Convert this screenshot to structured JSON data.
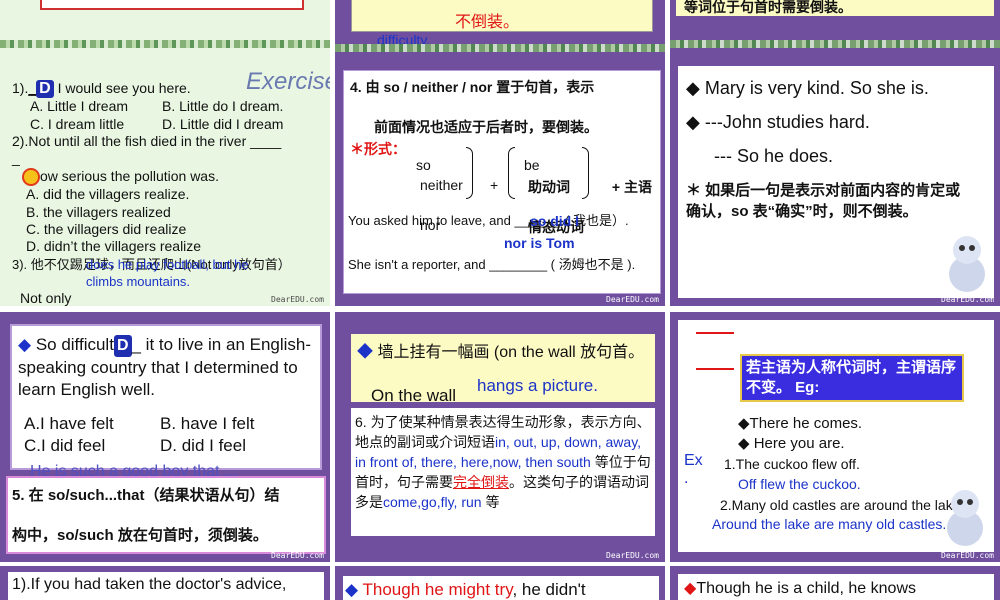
{
  "slides": {
    "s1": {
      "exercise_word": "Exercise",
      "q1_prefix": "1).",
      "q1_blank": "D",
      "q1_rest": " I would see you here.",
      "q1_a": "A. Little I dream",
      "q1_b": "B. Little do I dream.",
      "q1_c": "C. I dream little",
      "q1_d": "D. Little did I dream",
      "q2": "2).Not until all the fish died in the river ____",
      "q2_dash": "_",
      "q2_cont": "ow serious the pollution was.",
      "q2_a": "A. did the villagers realize.",
      "q2_b": "B. the villagers realized",
      "q2_c": "C. the villagers did realize",
      "q2_d": "D. didn’t the villagers realize",
      "q3": "3). 他不仅踢足球，而且还爬山(Not only放句首）",
      "q3_ans1": "does he play football, but he",
      "q3_ans2": "climbs mountains.",
      "q3_notonly": "Not only",
      "brand": "DearEDU.com"
    },
    "s2": {
      "top_red": "不倒装。",
      "top_blue": "difficulty.",
      "item4_line1": "4.   由 so / neither / nor 置于句首，表示",
      "item4_line2": "前面情况也适应于后者时，要倒装。",
      "form_label": "＊形式：",
      "f_so": "so",
      "f_neither": "neither",
      "f_nor": "nor",
      "f_be": "be",
      "f_aux": "助动词",
      "f_modal": "情态动词",
      "f_plus": "+",
      "f_subj": "+ 主语",
      "ex1": "You asked him to leave, and ______. ( 我也是）.",
      "ex1_ans": "so did I",
      "ex2": "She isn't a reporter, and ________ ( 汤姆也不是 ).",
      "ex2_ans": "nor is Tom",
      "brand": "DearEDU.com"
    },
    "s3": {
      "top": "等词位于句首时需要倒装。",
      "line1": "Mary is very kind. So she is.",
      "line2": "---John studies hard.",
      "line3": "--- So he does.",
      "note": "＊ 如果后一句是表示对前面内容的肯定或确认，so 表“确实”时，则不倒装。",
      "brand": "DearEDU.com"
    },
    "s4": {
      "q_start": "So difficult",
      "q_blank": "D",
      "q_rest": "_ it to live in an English-speaking country that I determined to learn English well.",
      "opt_a": "A.I have felt",
      "opt_b": "B. have I felt",
      "opt_c": "C.I did feel",
      "opt_d": "D. did I feel",
      "behind": "He is such a good boy that ...",
      "item5_line1": "5.  在 so/such...that（结果状语从句）结",
      "item5_line2": "构中，so/such  放在句首时，须倒装。",
      "brand": "DearEDU.com"
    },
    "s5": {
      "line1": "墙上挂有一幅画 (on the wall 放句首。",
      "line2": "On the wall",
      "line2_ans": "hangs a picture.",
      "item6_a": "6.  为了使某种情景表达得生动形象，表示方向、地点的副词或介词短语",
      "item6_words": "in, out, up, down, away, in front of, there, here,now, then  south",
      "item6_b": "等位于句首时，句子需要",
      "item6_red": "完全倒装",
      "item6_c": "。这类句子的谓语动词多是",
      "item6_verbs": "come,go,fly, run",
      "item6_d": "等",
      "brand": "DearEDU.com"
    },
    "s6": {
      "rule": "若主语为人称代词时，主谓语序不变。 Eg:",
      "ex_a": "There he comes.",
      "ex_b": "Here you are.",
      "ex_label": "Ex",
      "ex1": "1.The cuckoo flew off.",
      "ex1_ans": "Off flew the cuckoo.",
      "ex2": "2.Many old castles are around the lake.",
      "ex2_ans": "Around the lake are many old castles.",
      "brand": "DearEDU.com"
    },
    "s7": {
      "text": "1).If you had taken the doctor's advice,"
    },
    "s8": {
      "text_red": "Though he might try",
      "text_rest": ", he didn't"
    },
    "s9": {
      "text": "Though he is a child, he knows"
    }
  },
  "colors": {
    "purple": "#6f4f9e",
    "green": "#e9f6e2",
    "red": "#e01515",
    "blue": "#1b33c8",
    "highlight": "#fdfbc4",
    "rule_box": "#3a2de0"
  }
}
